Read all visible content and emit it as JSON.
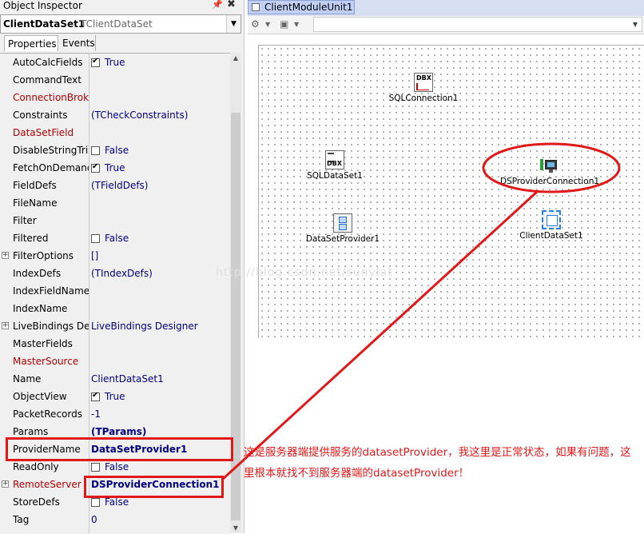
{
  "inspector": {
    "title": "Object Inspector",
    "pin_icon": "pin-icon",
    "close_icon": "close-icon",
    "selected_component": "ClientDataSet1",
    "selected_class": "TClientDataSet",
    "tabs": [
      {
        "label": "Properties",
        "active": true
      },
      {
        "label": "Events",
        "active": false
      }
    ],
    "properties": [
      {
        "name": "AutoCalcFields",
        "value": "True",
        "checkbox": "checked"
      },
      {
        "name": "CommandText",
        "value": ""
      },
      {
        "name": "ConnectionBroker",
        "value": "",
        "red": true
      },
      {
        "name": "Constraints",
        "value": "(TCheckConstraints)"
      },
      {
        "name": "DataSetField",
        "value": "",
        "red": true
      },
      {
        "name": "DisableStringTrim",
        "value": "False",
        "checkbox": "unchecked"
      },
      {
        "name": "FetchOnDemand",
        "value": "True",
        "checkbox": "checked"
      },
      {
        "name": "FieldDefs",
        "value": "(TFieldDefs)"
      },
      {
        "name": "FileName",
        "value": ""
      },
      {
        "name": "Filter",
        "value": ""
      },
      {
        "name": "Filtered",
        "value": "False",
        "checkbox": "unchecked"
      },
      {
        "name": "FilterOptions",
        "value": "[]",
        "expandable": true
      },
      {
        "name": "IndexDefs",
        "value": "(TIndexDefs)"
      },
      {
        "name": "IndexFieldNames",
        "value": ""
      },
      {
        "name": "IndexName",
        "value": ""
      },
      {
        "name": "LiveBindings Designer",
        "value": "LiveBindings Designer",
        "expandable": true
      },
      {
        "name": "MasterFields",
        "value": ""
      },
      {
        "name": "MasterSource",
        "value": "",
        "red": true
      },
      {
        "name": "Name",
        "value": "ClientDataSet1"
      },
      {
        "name": "ObjectView",
        "value": "True",
        "checkbox": "checked"
      },
      {
        "name": "PacketRecords",
        "value": "-1"
      },
      {
        "name": "Params",
        "value": "(TParams)",
        "bold": true
      },
      {
        "name": "ProviderName",
        "value": "DataSetProvider1",
        "bold": true
      },
      {
        "name": "ReadOnly",
        "value": "False",
        "checkbox": "unchecked"
      },
      {
        "name": "RemoteServer",
        "value": "DSProviderConnection1",
        "bold": true,
        "red": true,
        "expandable": true
      },
      {
        "name": "StoreDefs",
        "value": "False",
        "checkbox": "unchecked"
      },
      {
        "name": "Tag",
        "value": "0"
      }
    ]
  },
  "designer": {
    "tab_label": "ClientModuleUnit1",
    "components": [
      {
        "label": "SQLConnection1",
        "icon": "dbx-connection-icon"
      },
      {
        "label": "SQLDataSet1",
        "icon": "dbx-dataset-icon"
      },
      {
        "label": "DSProviderConnection1",
        "icon": "ds-provider-connection-icon"
      },
      {
        "label": "DataSetProvider1",
        "icon": "dataset-provider-icon"
      },
      {
        "label": "ClientDataSet1",
        "icon": "client-dataset-icon"
      }
    ]
  },
  "annotation": {
    "text": "这是服务器端提供服务的datasetProvider，我这里是正常状态，如果有问题，这里根本就找不到服务器端的datasetProvider！",
    "watermark": "http://blog.csdn.net/sunylat",
    "color": "#e01818"
  }
}
